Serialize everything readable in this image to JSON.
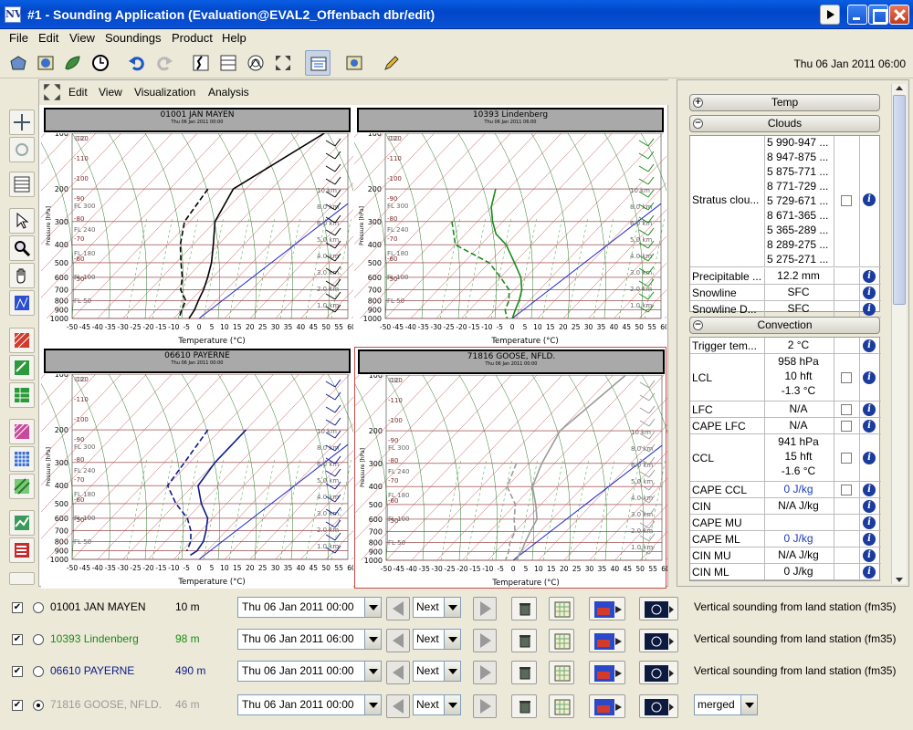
{
  "window": {
    "title": "#1 - Sounding Application (Evaluation@EVAL2_Offenbach dbr/edit)",
    "app_icon": "NV"
  },
  "menu": [
    "File",
    "Edit",
    "View",
    "Soundings",
    "Product",
    "Help"
  ],
  "toolbar": {
    "datetime": "Thu 06 Jan 2011 06:00"
  },
  "plot_menu": [
    "Edit",
    "View",
    "Visualization",
    "Analysis"
  ],
  "panels": [
    {
      "station": "01001 JAN MAYEN",
      "time": "Thu 06 Jan 2011 00:00",
      "color": "#000000"
    },
    {
      "station": "10393 Lindenberg",
      "time": "Thu 06 Jan 2011 06:00",
      "color": "#1a8a1a"
    },
    {
      "station": "06610 PAYERNE",
      "time": "Thu 06 Jan 2011 00:00",
      "color": "#0b1a8a"
    },
    {
      "station": "71816 GOOSE, NFLD.",
      "time": "Thu 06 Jan 2011 00:00",
      "color": "#9a9a9a"
    }
  ],
  "axis": {
    "pressure_ticks": [
      "100",
      "200",
      "300",
      "400",
      "500",
      "600",
      "700",
      "800",
      "900",
      "1000"
    ],
    "temp_ticks": [
      "-50",
      "-45",
      "-40",
      "-35",
      "-30",
      "-25",
      "-20",
      "-15",
      "-10",
      "-5",
      "0",
      "5",
      "10",
      "15",
      "20",
      "25",
      "30",
      "35",
      "40",
      "45",
      "50",
      "55",
      "60"
    ],
    "xlabel": "Temperature (°C)",
    "ylabel": "Pressure [hPa]",
    "top_label": "130",
    "iso_labels": [
      "-120",
      "-110",
      "-100",
      "-90",
      "-80",
      "-70",
      "-60",
      "-50"
    ],
    "fl_labels": [
      "FL 300",
      "FL 240",
      "FL 180",
      "FL 100",
      "FL 50"
    ],
    "km_labels": [
      "10 km",
      "8.0 km",
      "6.0 km",
      "5.0 km",
      "4.0 km",
      "3.0 km",
      "2.0 km",
      "1.0 km"
    ]
  },
  "right_panel": {
    "sections": {
      "temp": "Temp",
      "clouds": "Clouds",
      "convection": "Convection"
    },
    "stratus_label": "Stratus clou...",
    "stratus_values": [
      "5  990-947 ...",
      "8  947-875 ...",
      "5  875-771 ...",
      "8  771-729 ...",
      "5  729-671 ...",
      "8  671-365 ...",
      "5  365-289 ...",
      "8  289-275 ...",
      "5  275-271 ..."
    ],
    "cloud_rows": [
      {
        "label": "Precipitable ...",
        "value": "12.2 mm"
      },
      {
        "label": "Snowline",
        "value": "SFC"
      },
      {
        "label": "Snowline D...",
        "value": "SFC"
      }
    ],
    "conv_rows": [
      {
        "label": "Trigger tem...",
        "value": [
          "2 °C"
        ]
      },
      {
        "label": "LCL",
        "value": [
          "958 hPa",
          "10 hft",
          "-1.3 °C"
        ]
      },
      {
        "label": "LFC",
        "value": [
          "N/A"
        ]
      },
      {
        "label": "CAPE LFC",
        "value": [
          "N/A"
        ]
      },
      {
        "label": "CCL",
        "value": [
          "941 hPa",
          "15 hft",
          "-1.6 °C"
        ]
      },
      {
        "label": "CAPE CCL",
        "value": [
          "0 J/kg"
        ]
      },
      {
        "label": "CIN",
        "value": [
          "N/A J/kg"
        ]
      },
      {
        "label": "CAPE MU",
        "value": [
          ""
        ]
      },
      {
        "label": "CAPE ML",
        "value": [
          "0 J/kg"
        ]
      },
      {
        "label": "CIN MU",
        "value": [
          "N/A J/kg"
        ]
      },
      {
        "label": "CIN ML",
        "value": [
          "0 J/kg"
        ]
      }
    ]
  },
  "stations": [
    {
      "name": "01001 JAN MAYEN",
      "alt": "10 m",
      "time": "Thu 06 Jan 2011 00:00",
      "next": "Next",
      "desc": "Vertical sounding from land station (fm35)",
      "color": "#000000",
      "checked": "✔",
      "selected": false
    },
    {
      "name": "10393 Lindenberg",
      "alt": "98 m",
      "time": "Thu 06 Jan 2011 06:00",
      "next": "Next",
      "desc": "Vertical sounding from land station (fm35)",
      "color": "#1a8a1a",
      "checked": "✔",
      "selected": false
    },
    {
      "name": "06610 PAYERNE",
      "alt": "490 m",
      "time": "Thu 06 Jan 2011 00:00",
      "next": "Next",
      "desc": "Vertical sounding from land station (fm35)",
      "color": "#0b1a8a",
      "checked": "✔",
      "selected": false
    },
    {
      "name": "71816 GOOSE, NFLD.",
      "alt": "46 m",
      "time": "Thu 06 Jan 2011 00:00",
      "next": "Next",
      "desc": "",
      "mode": "merged",
      "color": "#9a9a9a",
      "checked": "✔",
      "selected": true
    }
  ]
}
